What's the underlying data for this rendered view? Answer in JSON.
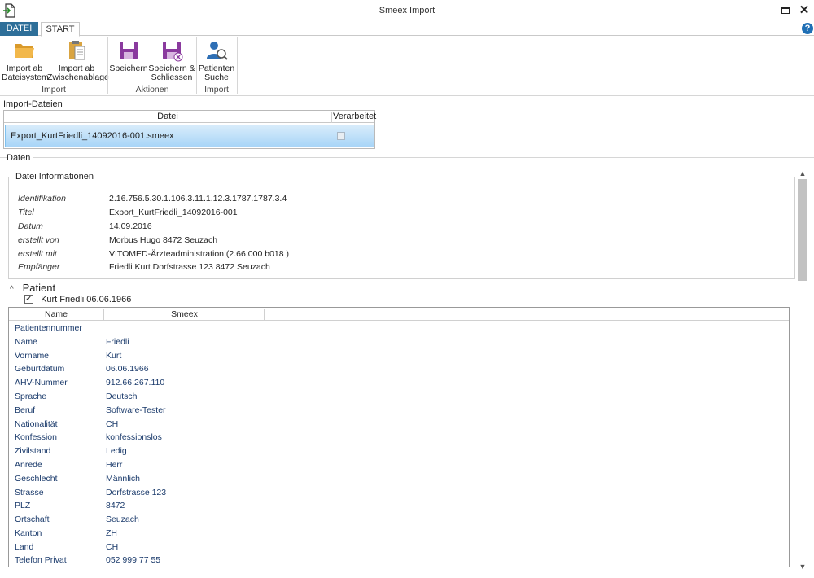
{
  "window": {
    "title": "Smeex Import"
  },
  "tabs": [
    {
      "label": "DATEI"
    },
    {
      "label": "START"
    }
  ],
  "ribbon": {
    "buttons": [
      {
        "label": "Import ab\nDateisystem",
        "icon": "folder-icon"
      },
      {
        "label": "Import ab\nZwischenablage",
        "icon": "clipboard-icon"
      },
      {
        "label": "Speichern",
        "icon": "save-icon"
      },
      {
        "label": "Speichern &\nSchliessen",
        "icon": "save-close-icon"
      },
      {
        "label": "Patienten\nSuche",
        "icon": "patient-search-icon"
      }
    ],
    "groups": [
      {
        "label": "Import"
      },
      {
        "label": "Aktionen"
      },
      {
        "label": "Import"
      }
    ]
  },
  "import_files": {
    "section_label": "Import-Dateien",
    "col_file": "Datei",
    "col_processed": "Verarbeitet",
    "rows": [
      {
        "file": "Export_KurtFriedli_14092016-001.smeex",
        "processed": false
      }
    ]
  },
  "daten": {
    "section_label": "Daten",
    "info_label": "Datei Informationen",
    "info": [
      {
        "key": "Identifikation",
        "value": "2.16.756.5.30.1.106.3.11.1.12.3.1787.1787.3.4"
      },
      {
        "key": "Titel",
        "value": "Export_KurtFriedli_14092016-001"
      },
      {
        "key": "Datum",
        "value": "14.09.2016"
      },
      {
        "key": "erstellt von",
        "value": " Morbus Hugo 8472 Seuzach"
      },
      {
        "key": "erstellt mit",
        "value": "VITOMED-Ärzteadministration  (2.66.000 b018 )"
      },
      {
        "key": "Empfänger",
        "value": " Friedli Kurt Dorfstrasse 123 8472 Seuzach"
      }
    ]
  },
  "patient": {
    "header": "Patient",
    "checkbox_label": "Kurt Friedli 06.06.1966",
    "checked": true,
    "col_name": "Name",
    "col_smeex": "Smeex",
    "rows": [
      {
        "name": "Patientennummer",
        "value": ""
      },
      {
        "name": "Name",
        "value": "Friedli"
      },
      {
        "name": "Vorname",
        "value": "Kurt"
      },
      {
        "name": "Geburtdatum",
        "value": "06.06.1966"
      },
      {
        "name": "AHV-Nummer",
        "value": "912.66.267.110"
      },
      {
        "name": "Sprache",
        "value": "Deutsch"
      },
      {
        "name": "Beruf",
        "value": "Software-Tester"
      },
      {
        "name": "Nationalität",
        "value": "CH"
      },
      {
        "name": "Konfession",
        "value": "konfessionslos"
      },
      {
        "name": "Zivilstand",
        "value": "Ledig"
      },
      {
        "name": "Anrede",
        "value": "Herr"
      },
      {
        "name": "Geschlecht",
        "value": "Männlich"
      },
      {
        "name": "Strasse",
        "value": "Dorfstrasse 123"
      },
      {
        "name": "PLZ",
        "value": "8472"
      },
      {
        "name": "Ortschaft",
        "value": "Seuzach"
      },
      {
        "name": "Kanton",
        "value": "ZH"
      },
      {
        "name": "Land",
        "value": "CH"
      },
      {
        "name": "Telefon Privat",
        "value": "052 999 77 55"
      }
    ]
  },
  "colors": {
    "accent": "#2e6f99",
    "selection": "#a8d5f7",
    "icon_purple": "#8a3a9e"
  }
}
